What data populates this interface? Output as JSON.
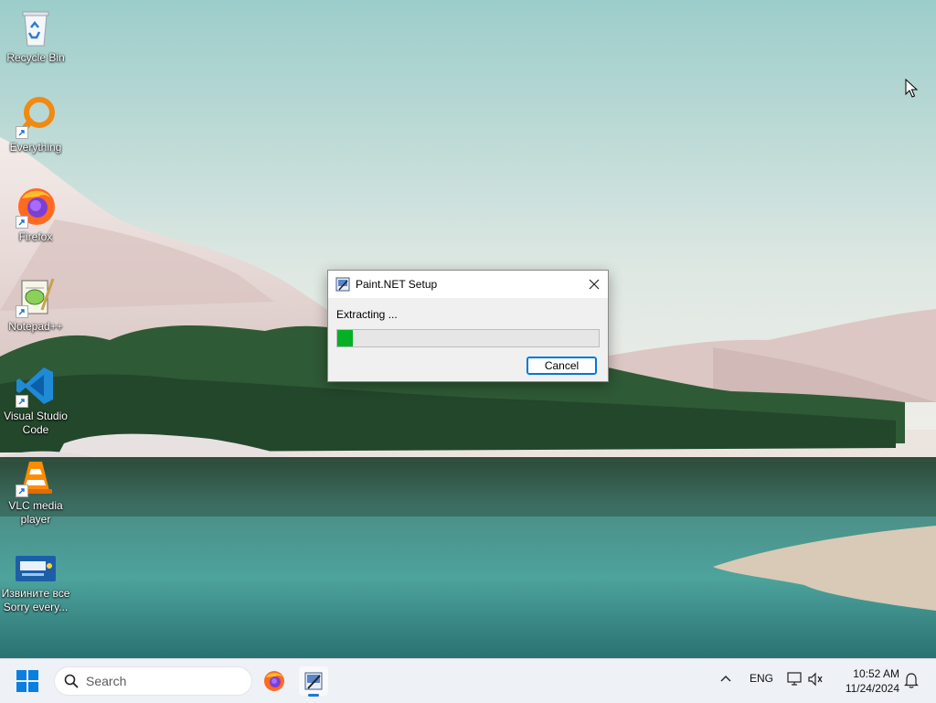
{
  "desktop": {
    "icons": [
      {
        "label": "Recycle Bin",
        "icon": "recycle-bin-icon"
      },
      {
        "label": "Everything",
        "icon": "everything-search-icon"
      },
      {
        "label": "Firefox",
        "icon": "firefox-icon"
      },
      {
        "label": "Notepad++",
        "icon": "notepad-plus-plus-icon"
      },
      {
        "label": "Visual Studio Code",
        "icon": "vscode-icon"
      },
      {
        "label": "VLC media player",
        "icon": "vlc-icon"
      },
      {
        "label": "Извините все Sorry every...",
        "icon": "sorry-file-icon"
      }
    ]
  },
  "dialog": {
    "title": "Paint.NET Setup",
    "status": "Extracting ...",
    "progress_percent": 6,
    "cancel_label": "Cancel"
  },
  "taskbar": {
    "search_placeholder": "Search",
    "apps": [
      "firefox-icon",
      "paintnet-installer-icon"
    ],
    "tray": {
      "language": "ENG",
      "time": "10:52 AM",
      "date": "11/24/2024"
    }
  },
  "colors": {
    "progress_fill": "#06b025",
    "accent": "#0078d4",
    "taskbar_bg": "#eef1f5"
  }
}
